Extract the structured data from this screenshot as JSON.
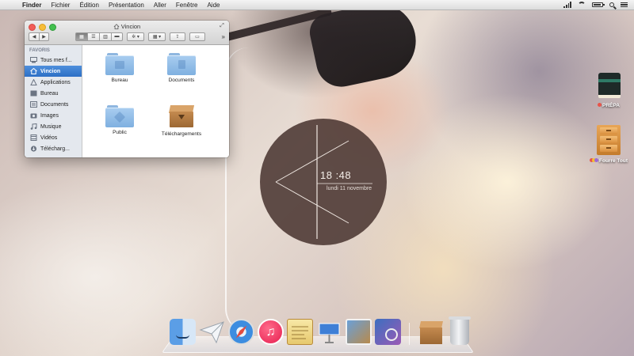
{
  "menubar": {
    "apple_glyph": "",
    "app_name": "Finder",
    "items": [
      "Fichier",
      "Édition",
      "Présentation",
      "Aller",
      "Fenêtre",
      "Aide"
    ]
  },
  "finder": {
    "title": "Vincion",
    "sidebar_heading": "FAVORIS",
    "sidebar": [
      {
        "label": "Tous mes f...",
        "icon": "all-files-icon"
      },
      {
        "label": "Vincion",
        "icon": "home-icon",
        "selected": true
      },
      {
        "label": "Applications",
        "icon": "applications-icon"
      },
      {
        "label": "Bureau",
        "icon": "desktop-icon"
      },
      {
        "label": "Documents",
        "icon": "documents-icon"
      },
      {
        "label": "Images",
        "icon": "camera-icon"
      },
      {
        "label": "Musique",
        "icon": "music-icon"
      },
      {
        "label": "Vidéos",
        "icon": "film-icon"
      },
      {
        "label": "Télécharg...",
        "icon": "download-icon"
      }
    ],
    "files": [
      {
        "label": "Bureau",
        "icon": "folder-desktop-icon"
      },
      {
        "label": "Documents",
        "icon": "folder-documents-icon"
      },
      {
        "label": "Public",
        "icon": "folder-public-icon"
      },
      {
        "label": "Téléchargements",
        "icon": "box-downloads-icon"
      }
    ]
  },
  "clock": {
    "time": "18 :48",
    "date": "lundi 11 novembre"
  },
  "desktop": {
    "items": [
      {
        "label": "PRÉPA",
        "icon": "notebook-icon",
        "tag_colors": [
          "#e8544a"
        ]
      },
      {
        "label": "Fourre Tout",
        "icon": "filing-cabinet-icon",
        "tag_colors": [
          "#e8544a",
          "#f2c230",
          "#9d6ad6"
        ]
      }
    ]
  },
  "dock": {
    "apps": [
      "Finder",
      "Mail",
      "Safari",
      "iTunes",
      "Notes",
      "Keynote",
      "iPhoto",
      "Aperçu"
    ],
    "right": [
      "Téléchargements",
      "Corbeille"
    ]
  },
  "colors": {
    "sidebar_selected": "#2c6fc5",
    "clock_bg": "#4b3732"
  }
}
